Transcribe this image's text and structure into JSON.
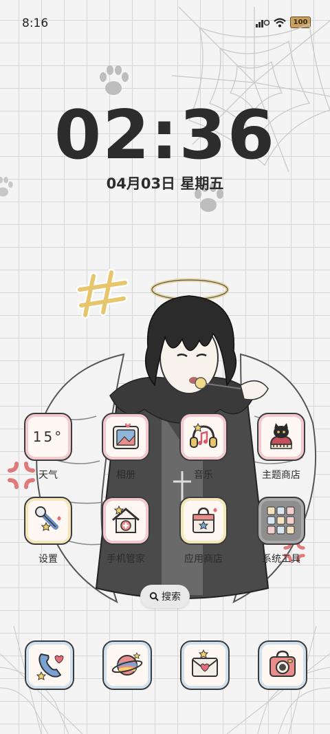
{
  "status_bar": {
    "time": "8:16",
    "battery": "100"
  },
  "lock": {
    "clock": "02:36",
    "date": "04月03日 星期五"
  },
  "apps_row1": [
    {
      "label": "天气",
      "weather": "15°"
    },
    {
      "label": "相册"
    },
    {
      "label": "音乐"
    },
    {
      "label": "主题商店"
    }
  ],
  "apps_row2": [
    {
      "label": "设置"
    },
    {
      "label": "手机管家"
    },
    {
      "label": "应用商店"
    },
    {
      "label": "系统工具"
    }
  ],
  "search": {
    "label": "搜索"
  },
  "dock": [
    {
      "icon": "phone-icon"
    },
    {
      "icon": "planet-icon"
    },
    {
      "icon": "messages-icon"
    },
    {
      "icon": "camera-icon"
    }
  ],
  "colors": {
    "icon_border": "#3b3b3b",
    "icon_inner_pink": "#f2c9cf",
    "icon_inner_blue": "#cfe0ef",
    "text": "#2c2c2c"
  }
}
